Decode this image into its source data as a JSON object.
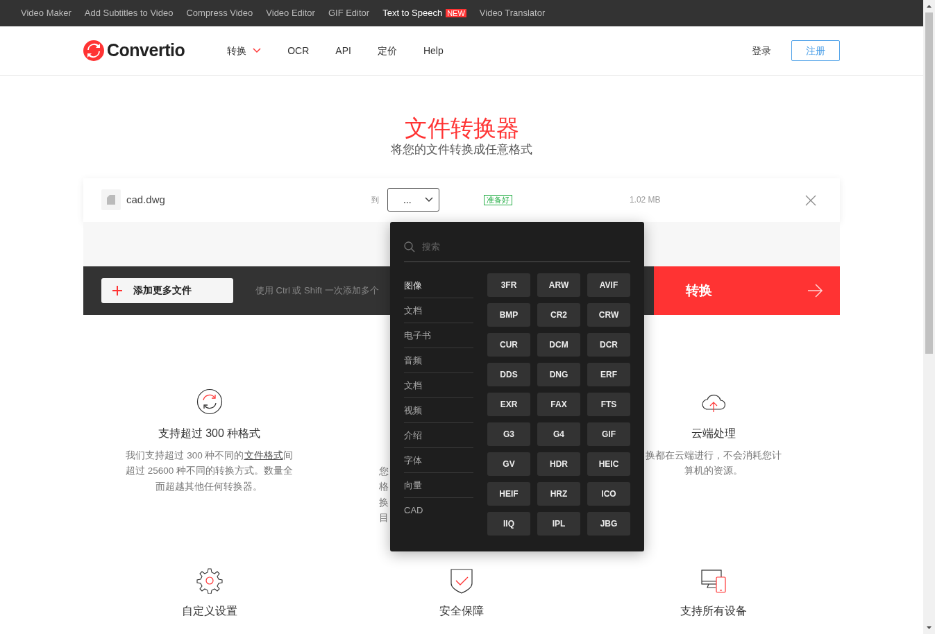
{
  "top_links": [
    {
      "label": "Video Maker"
    },
    {
      "label": "Add Subtitles to Video"
    },
    {
      "label": "Compress Video"
    },
    {
      "label": "Video Editor"
    },
    {
      "label": "GIF Editor"
    },
    {
      "label": "Text to Speech",
      "badge": "NEW"
    },
    {
      "label": "Video Translator"
    }
  ],
  "header": {
    "logo": "Convertio",
    "nav": [
      {
        "label": "转换",
        "dropdown": true
      },
      {
        "label": "OCR",
        "dropdown": false
      },
      {
        "label": "API",
        "dropdown": false
      },
      {
        "label": "定价",
        "dropdown": false
      },
      {
        "label": "Help",
        "dropdown": false
      }
    ],
    "login": "登录",
    "signup": "注册"
  },
  "hero": {
    "title": "文件转换器",
    "subtitle": "将您的文件转换成任意格式"
  },
  "file": {
    "name": "cad.dwg",
    "to_label": "到",
    "format": "...",
    "status": "准备好",
    "size": "1.02 MB"
  },
  "toolbar": {
    "add_button": "添加更多文件",
    "hint": "使用 Ctrl 或 Shift 一次添加多个",
    "convert_button": "转换"
  },
  "format_menu": {
    "search": {
      "placeholder": "搜索"
    },
    "categories": [
      {
        "label": "图像",
        "selected": true
      },
      {
        "label": "文档",
        "selected": false
      },
      {
        "label": "电子书",
        "selected": false
      },
      {
        "label": "音频",
        "selected": false
      },
      {
        "label": "文档",
        "selected": false
      },
      {
        "label": "视频",
        "selected": false
      },
      {
        "label": "介绍",
        "selected": false
      },
      {
        "label": "字体",
        "selected": false
      },
      {
        "label": "向量",
        "selected": false
      },
      {
        "label": "CAD",
        "selected": false
      }
    ],
    "formats": [
      "3FR",
      "ARW",
      "AVIF",
      "BMP",
      "CR2",
      "CRW",
      "CUR",
      "DCM",
      "DCR",
      "DDS",
      "DNG",
      "ERF",
      "EXR",
      "FAX",
      "FTS",
      "G3",
      "G4",
      "GIF",
      "GV",
      "HDR",
      "HEIC",
      "HEIF",
      "HRZ",
      "ICO",
      "IIQ",
      "IPL",
      "JBG"
    ]
  },
  "features": [
    {
      "kind": "sync",
      "title": "支持超过 300 种格式",
      "lines": [
        [
          {
            "text": "我们支持超过 300 种不同的"
          },
          {
            "text": "文件格式",
            "link": true
          },
          {
            "text": "间"
          }
        ],
        [
          {
            "text": "超过 25600 种不同的转换方式。数量全"
          }
        ],
        [
          {
            "text": "面超越其他任何转换器。"
          }
        ]
      ]
    },
    {
      "kind": "covered",
      "lines": [
        [
          {
            "text": "您"
          }
        ],
        [
          {
            "text": "格"
          }
        ],
        [
          {
            "text": "换"
          }
        ],
        [
          {
            "text": "目"
          }
        ]
      ]
    },
    {
      "kind": "cloud",
      "title": "云端处理",
      "lines": [
        [
          {
            "text": "换都在云端进行，不会消耗您计"
          }
        ],
        [
          {
            "text": "算机的资源。"
          }
        ]
      ]
    },
    {
      "kind": "gear",
      "title": "自定义设置"
    },
    {
      "kind": "shield",
      "title": "安全保障"
    },
    {
      "kind": "devices",
      "title": "支持所有设备"
    }
  ]
}
